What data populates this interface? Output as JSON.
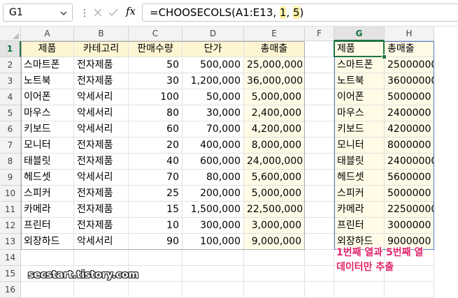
{
  "formula_bar": {
    "name_box": "G1",
    "separator": "⋮",
    "cancel_icon": "close-icon",
    "enter_icon": "check-icon",
    "fx_label": "fx",
    "formula_prefix": "=CHOOSECOLS(A1:E13, ",
    "formula_arg1": "1",
    "formula_mid": ", ",
    "formula_arg2": "5",
    "formula_suffix": ")"
  },
  "columns": [
    "A",
    "B",
    "C",
    "D",
    "E",
    "F",
    "G",
    "H"
  ],
  "rows": [
    "1",
    "2",
    "3",
    "4",
    "5",
    "6",
    "7",
    "8",
    "9",
    "10",
    "11",
    "12",
    "13",
    "14",
    "15",
    "16"
  ],
  "table": {
    "headers": [
      "제품",
      "카테고리",
      "판매수량",
      "단가",
      "총매출"
    ],
    "rows": [
      [
        "스마트폰",
        "전자제품",
        "50",
        "500,000",
        "25,000,000"
      ],
      [
        "노트북",
        "전자제품",
        "30",
        "1,200,000",
        "36,000,000"
      ],
      [
        "이어폰",
        "악세서리",
        "100",
        "50,000",
        "5,000,000"
      ],
      [
        "마우스",
        "악세서리",
        "80",
        "30,000",
        "2,400,000"
      ],
      [
        "키보드",
        "악세서리",
        "60",
        "70,000",
        "4,200,000"
      ],
      [
        "모니터",
        "전자제품",
        "20",
        "400,000",
        "8,000,000"
      ],
      [
        "태블릿",
        "전자제품",
        "40",
        "600,000",
        "24,000,000"
      ],
      [
        "헤드셋",
        "악세서리",
        "70",
        "80,000",
        "5,600,000"
      ],
      [
        "스피커",
        "전자제품",
        "25",
        "200,000",
        "5,000,000"
      ],
      [
        "카메라",
        "전자제품",
        "15",
        "1,500,000",
        "22,500,000"
      ],
      [
        "프린터",
        "전자제품",
        "10",
        "300,000",
        "3,000,000"
      ],
      [
        "외장하드",
        "악세서리",
        "90",
        "100,000",
        "9,000,000"
      ]
    ]
  },
  "result": {
    "headers": [
      "제품",
      "총매출"
    ],
    "rows": [
      [
        "스마트폰",
        "25000000"
      ],
      [
        "노트북",
        "36000000"
      ],
      [
        "이어폰",
        "5000000"
      ],
      [
        "마우스",
        "2400000"
      ],
      [
        "키보드",
        "4200000"
      ],
      [
        "모니터",
        "8000000"
      ],
      [
        "태블릿",
        "24000000"
      ],
      [
        "헤드셋",
        "5600000"
      ],
      [
        "스피커",
        "5000000"
      ],
      [
        "카메라",
        "22500000"
      ],
      [
        "프린터",
        "3000000"
      ],
      [
        "외장하드",
        "9000000"
      ]
    ]
  },
  "annotation": {
    "line1": "1번째 열과 5번째 열",
    "line2": "데이터만 추출"
  },
  "watermark": "secstart.tistory.com",
  "colors": {
    "accent": "#217346",
    "header_fill": "#fef6d3",
    "result_fill": "#fffbe6",
    "annotation": "#e0256a"
  }
}
